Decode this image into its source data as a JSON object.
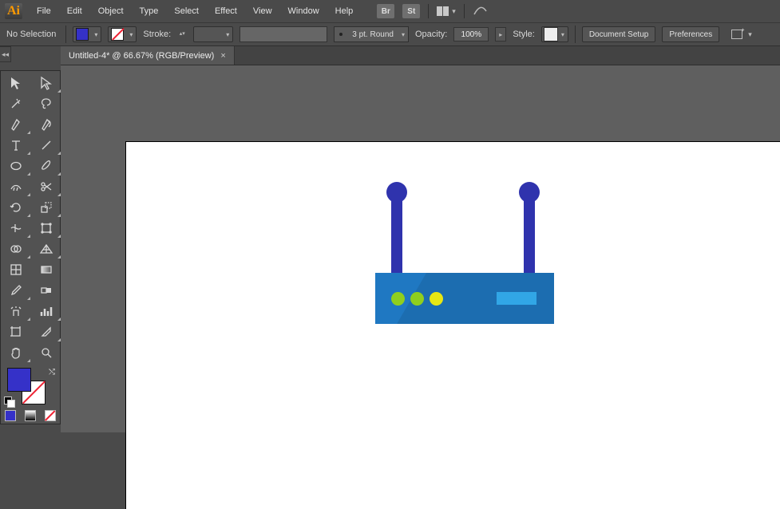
{
  "app": {
    "logo_text": "Ai"
  },
  "menu": {
    "items": [
      "File",
      "Edit",
      "Object",
      "Type",
      "Select",
      "Effect",
      "View",
      "Window",
      "Help"
    ]
  },
  "menubar_extras": {
    "bridge": "Br",
    "stock": "St"
  },
  "control": {
    "selection_status": "No Selection",
    "stroke_label": "Stroke:",
    "stroke_weight": "",
    "var_width_profile": "3 pt. Round",
    "opacity_label": "Opacity:",
    "opacity_value": "100%",
    "style_label": "Style:",
    "doc_setup": "Document Setup",
    "preferences": "Preferences"
  },
  "tabs": [
    {
      "title": "Untitled-4* @ 66.67% (RGB/Preview)"
    }
  ],
  "tools": {
    "row0": [
      "selection-tool",
      "direct-selection-tool"
    ],
    "row1": [
      "magic-wand-tool",
      "lasso-tool"
    ],
    "row2": [
      "pen-tool",
      "curvature-tool"
    ],
    "row3": [
      "type-tool",
      "line-segment-tool"
    ],
    "row4": [
      "ellipse-tool",
      "paintbrush-tool"
    ],
    "row5": [
      "shaper-tool",
      "scissors-tool"
    ],
    "row6": [
      "rotate-tool",
      "scale-tool"
    ],
    "row7": [
      "width-tool",
      "free-transform-tool"
    ],
    "row8": [
      "shape-builder-tool",
      "perspective-grid-tool"
    ],
    "row9": [
      "mesh-tool",
      "gradient-tool"
    ],
    "row10": [
      "eyedropper-tool",
      "blend-tool"
    ],
    "row11": [
      "symbol-sprayer-tool",
      "column-graph-tool"
    ],
    "row12": [
      "artboard-tool",
      "slice-tool"
    ],
    "row13": [
      "hand-tool",
      "zoom-tool"
    ]
  },
  "colors": {
    "fill": "#3531c8",
    "stroke": "none",
    "router_body": "#1f78c2",
    "router_antenna": "#2f33ad",
    "router_led_green": "#8fcf1e",
    "router_led_yellow": "#e7e713",
    "router_port": "#31a6e6"
  }
}
